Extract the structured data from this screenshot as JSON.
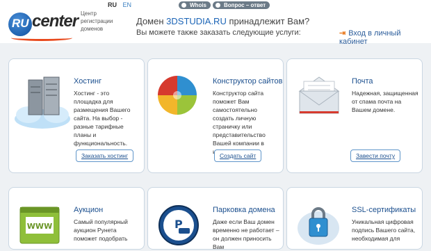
{
  "header": {
    "logo_word": "center",
    "logo_ru": "RU",
    "logo_tagline": [
      "Центр",
      "регистрации",
      "доменов"
    ],
    "lang_ru": "RU",
    "lang_en": "EN",
    "whois_label": "Whois",
    "faq_label": "Вопрос – ответ",
    "domain_prefix": "Домен",
    "domain_name": "3DSTUDIA.RU",
    "domain_suffix": "принадлежит Вам?",
    "offer_text": "Вы можете также заказать следующие услуги:",
    "login_label": "Вход в личный кабинет"
  },
  "services": [
    {
      "title": "Хостинг",
      "text": "Хостинг - это площадка для размещения Вашего сайта. На выбор - разные тарифные планы и функциональность.",
      "button": "Заказать хостинг"
    },
    {
      "title": "Конструктор сайтов",
      "text": "Конструктор сайта поможет Вам самостоятельно создать личную страничку или представительство Вашей компании в интернете.",
      "button": "Создать сайт"
    },
    {
      "title": "Почта",
      "text": "Надежная, защищенная от спама почта на Вашем домене.",
      "button": "Завести почту"
    },
    {
      "title": "Аукцион",
      "text": "Самый популярный аукцион Рунета поможет подобрать"
    },
    {
      "title": "Парковка домена",
      "text": "Даже если Ваш домен временно не работает – он должен приносить Вам"
    },
    {
      "title": "SSL-сертификаты",
      "text": "Уникальная цифровая подпись Вашего сайта, необходимая для"
    }
  ],
  "colors": {
    "accent": "#1b4f8e",
    "logo_red": "#e8491d",
    "login_arrow": "#e97a1f"
  }
}
